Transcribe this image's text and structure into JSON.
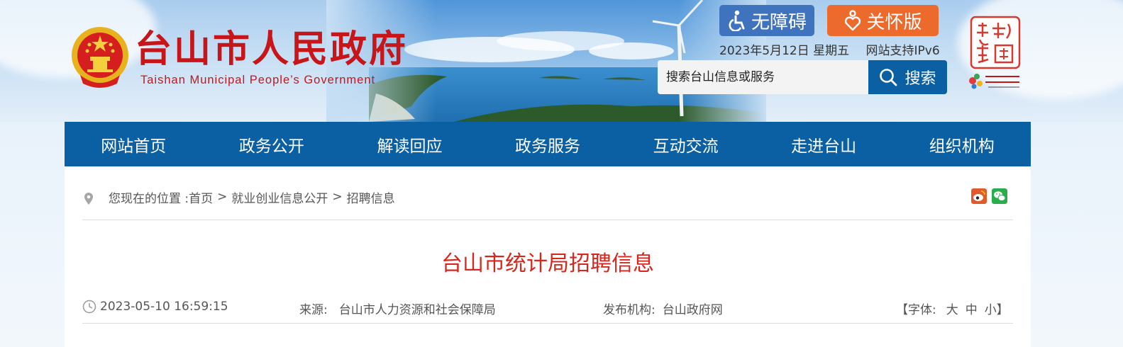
{
  "header": {
    "site_title": "台山市人民政府",
    "site_subtitle": "Taishan Municipal People’s Government",
    "accessibility_label": "无障碍",
    "care_label": "关怀版",
    "date": "2023年5月12日 星期五",
    "ipv6": "网站支持IPv6",
    "search_placeholder": "搜索台山信息或服务",
    "search_label": "搜索"
  },
  "nav": {
    "items": [
      "网站首页",
      "政务公开",
      "解读回应",
      "政务服务",
      "互动交流",
      "走进台山",
      "组织机构"
    ]
  },
  "breadcrumb": {
    "prefix": "您现在的位置 : ",
    "home": "首页",
    "separator": ">",
    "section": "就业创业信息公开",
    "current": "招聘信息"
  },
  "article": {
    "title": "台山市统计局招聘信息",
    "datetime": "2023-05-10 16:59:15",
    "source_label": "来源:",
    "source": "台山市人力资源和社会保障局",
    "publisher_label": "发布机构:",
    "publisher": "台山政府网",
    "font_open": "【字体:",
    "font_large": "大",
    "font_medium": "中",
    "font_small": "小】"
  },
  "colors": {
    "brand_red": "#c6161a",
    "nav_blue": "#0b5fa3",
    "access_blue": "#3f73bd",
    "care_orange": "#ec6a2c",
    "title_red": "#d9261c"
  },
  "icons": [
    "national-emblem-icon",
    "wheelchair-icon",
    "care-heart-icon",
    "search-icon",
    "location-pin-icon",
    "weibo-icon",
    "wechat-icon",
    "clock-icon"
  ]
}
